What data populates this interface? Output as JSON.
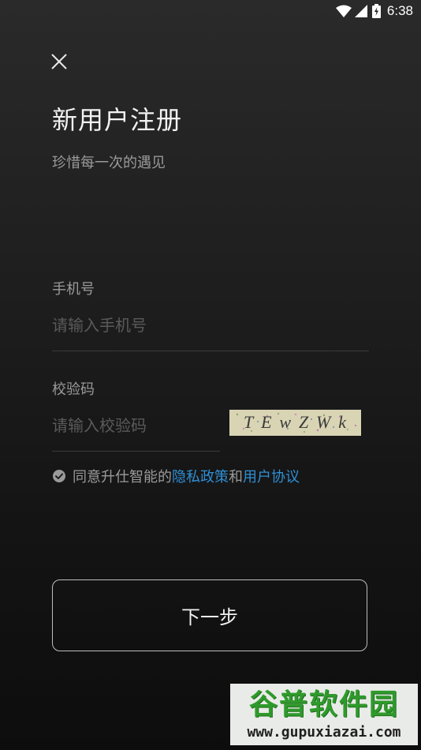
{
  "status_bar": {
    "time": "6:38",
    "icons": [
      "wifi-icon",
      "cell-signal-icon",
      "battery-icon"
    ]
  },
  "header": {
    "close_icon": "close-icon",
    "title": "新用户注册",
    "subtitle": "珍惜每一次的遇见"
  },
  "phone": {
    "label": "手机号",
    "value": "",
    "placeholder": "请输入手机号"
  },
  "code": {
    "label": "校验码",
    "value": "",
    "placeholder": "请输入校验码",
    "captcha_text": "TEwZWk"
  },
  "agreement": {
    "prefix": "同意升仕智能的",
    "privacy_link": "隐私政策",
    "conjunction": "和",
    "terms_link": "用户协议",
    "checked": true
  },
  "next_button": {
    "label": "下一步"
  },
  "watermark": {
    "title": "谷普软件园",
    "url": "www.gupuxiazai.com"
  },
  "colors": {
    "background_top": "#2a2a2a",
    "background_bottom": "#0d0d0d",
    "link": "#2f8fd6",
    "muted_text": "#9a9a9a",
    "placeholder": "#5a5a5a",
    "watermark_green": "#2f9a2c"
  }
}
